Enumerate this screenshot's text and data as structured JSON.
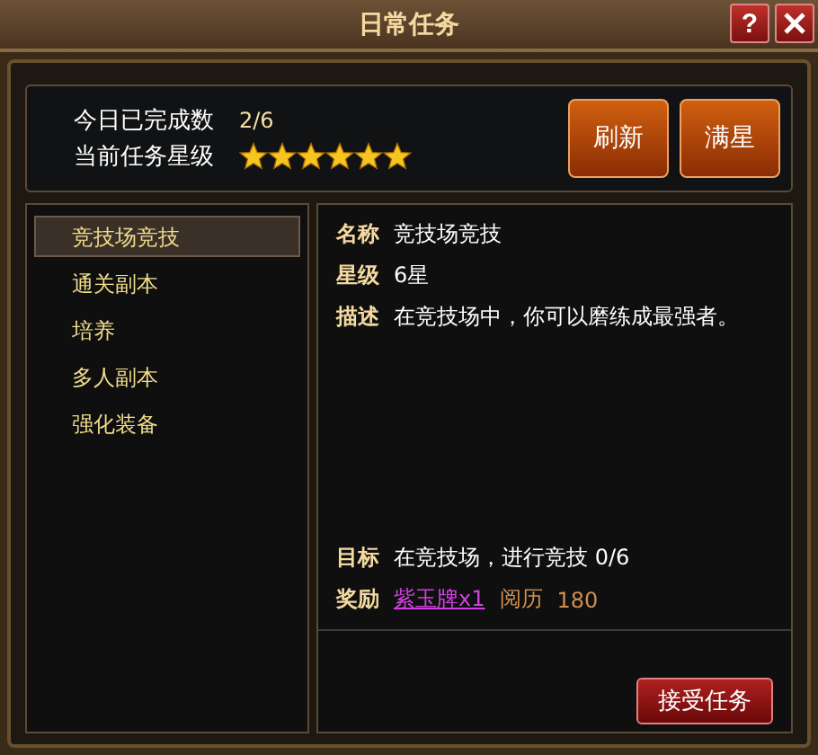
{
  "window": {
    "title": "日常任务",
    "help_button": "?"
  },
  "summary": {
    "completed_label": "今日已完成数",
    "completed_value": "2/6",
    "stars_label": "当前任务星级",
    "stars": 6,
    "buttons": [
      "刷新",
      "满星"
    ]
  },
  "sidebar": {
    "items": [
      {
        "label": "竞技场竞技",
        "selected": true
      },
      {
        "label": "通关副本",
        "selected": false
      },
      {
        "label": "培养",
        "selected": false
      },
      {
        "label": "多人副本",
        "selected": false
      },
      {
        "label": "强化装备",
        "selected": false
      }
    ]
  },
  "details": {
    "fields": [
      {
        "label": "名称",
        "value": "竞技场竞技"
      },
      {
        "label": "星级",
        "value": "6星"
      },
      {
        "label": "描述",
        "value": "在竞技场中，你可以磨练成最强者。"
      }
    ],
    "goal": {
      "label": "目标",
      "value": "在竞技场，进行竞技 0/6"
    },
    "reward": {
      "label": "奖励",
      "item": "紫玉牌x1",
      "extra_label": "阅历",
      "extra_value": "180"
    }
  },
  "accept_button": "接受任务"
}
